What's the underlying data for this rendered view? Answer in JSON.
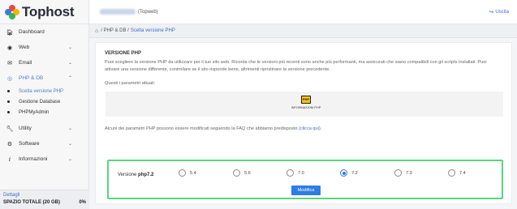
{
  "brand": {
    "name": "Tophost"
  },
  "topbar": {
    "account_suffix": "(Topweb)",
    "logout_label": "Uscita"
  },
  "sidebar": {
    "items": [
      {
        "label": "Dashboard",
        "icon": "home-icon"
      },
      {
        "label": "Web",
        "icon": "globe-icon"
      },
      {
        "label": "Email",
        "icon": "mail-icon"
      },
      {
        "label": "PHP & DB",
        "icon": "php-icon"
      },
      {
        "label": "Utility",
        "icon": "wrench-icon"
      },
      {
        "label": "Software",
        "icon": "gear-icon"
      },
      {
        "label": "Informazioni",
        "icon": "info-icon"
      }
    ],
    "sub_items": [
      "Scelta versione PHP",
      "Gestione Database",
      "PHPMyAdmin"
    ],
    "footer": {
      "link": "Dettagli",
      "label": "SPAZIO TOTALE (20 GB)",
      "value": "0%"
    }
  },
  "breadcrumb": {
    "section": "/ PHP & DB /",
    "current": "Scelta versione PHP"
  },
  "content": {
    "title": "VERSIONE PHP",
    "description": "Puoi scegliere la versione PHP da utilizzare per il tuo sito web. Ricorda che le versioni più recenti sono anche più performanti, ma assicurati che siano compatibili con gli scripts installati. Puoi attivare una versione differente, controllare se il sito risponde bene, altrimenti ripristinare la versione precedente.",
    "params_label": "Questi i parametri attuali:",
    "php_info_label": "INFORMAZIONI PHP",
    "php_icon_text": "PHP",
    "faq_text": "Alcuni dei parametri PHP possono essere modificati seguendo la FAQ che abbiamo predisposto (",
    "faq_link": "clicca qui",
    "faq_end": ").",
    "version_label": "Versione",
    "current_version": "php7.2",
    "options": [
      "5.4",
      "5.6",
      "7.0",
      "7.2",
      "7.3",
      "7.4"
    ],
    "selected": "7.2",
    "submit_label": "Modifica"
  },
  "colors": {
    "accent": "#2e7ce8",
    "highlight_border": "#58d680",
    "link": "#3a6fc8"
  }
}
